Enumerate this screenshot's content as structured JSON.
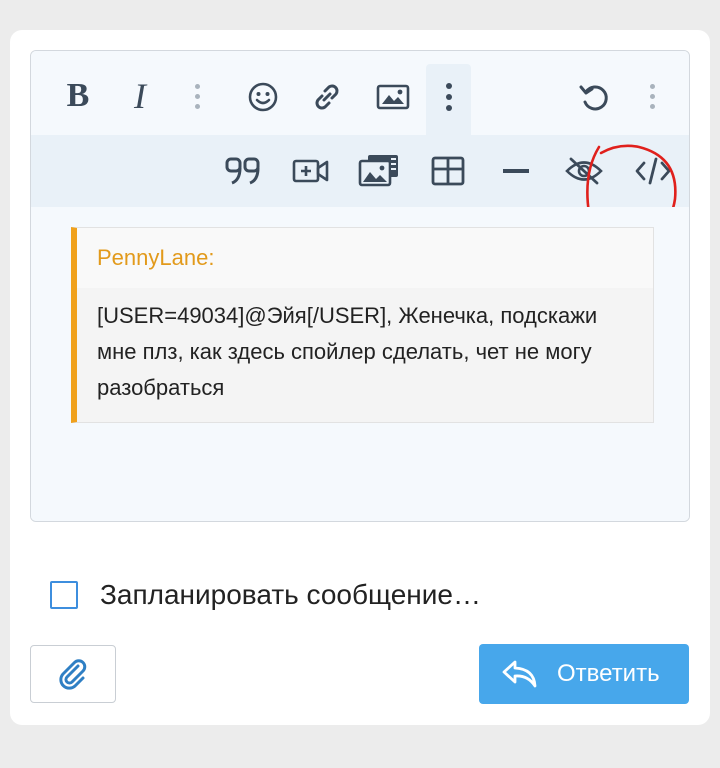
{
  "toolbar": {
    "row1": [
      {
        "name": "bold-button",
        "icon": "bold-icon",
        "label": "B"
      },
      {
        "name": "italic-button",
        "icon": "italic-icon",
        "label": "I"
      },
      {
        "name": "more-text-options-button",
        "icon": "vertical-dots-icon"
      },
      {
        "name": "emoji-button",
        "icon": "smiley-icon"
      },
      {
        "name": "link-button",
        "icon": "link-icon"
      },
      {
        "name": "image-button",
        "icon": "image-icon"
      },
      {
        "name": "more-insert-options-button",
        "icon": "vertical-dots-icon",
        "active": true
      },
      {
        "name": "undo-button",
        "icon": "undo-icon"
      },
      {
        "name": "more-options-button",
        "icon": "vertical-dots-icon"
      }
    ],
    "row2": [
      {
        "name": "quote-button",
        "icon": "quote-icon"
      },
      {
        "name": "media-button",
        "icon": "video-icon"
      },
      {
        "name": "gallery-button",
        "icon": "gallery-icon"
      },
      {
        "name": "table-button",
        "icon": "table-icon"
      },
      {
        "name": "horizontal-line-button",
        "icon": "minus-icon"
      },
      {
        "name": "spoiler-button",
        "icon": "eye-slash-icon",
        "highlighted": true
      },
      {
        "name": "code-button",
        "icon": "code-icon"
      }
    ]
  },
  "quote": {
    "author": "PennyLane:",
    "text": "[USER=49034]@Эйя[/USER], Женечка, подскажи мне плз, как здесь спойлер сделать, чет не могу разобраться"
  },
  "schedule": {
    "label": "Запланировать сообщение…",
    "checked": false
  },
  "actions": {
    "attach_icon": "paperclip-icon",
    "reply_label": "Ответить",
    "reply_icon": "reply-icon"
  },
  "colors": {
    "accent": "#47a7eb",
    "quote_bar": "#f0a11c",
    "annotation": "#e0201c"
  }
}
